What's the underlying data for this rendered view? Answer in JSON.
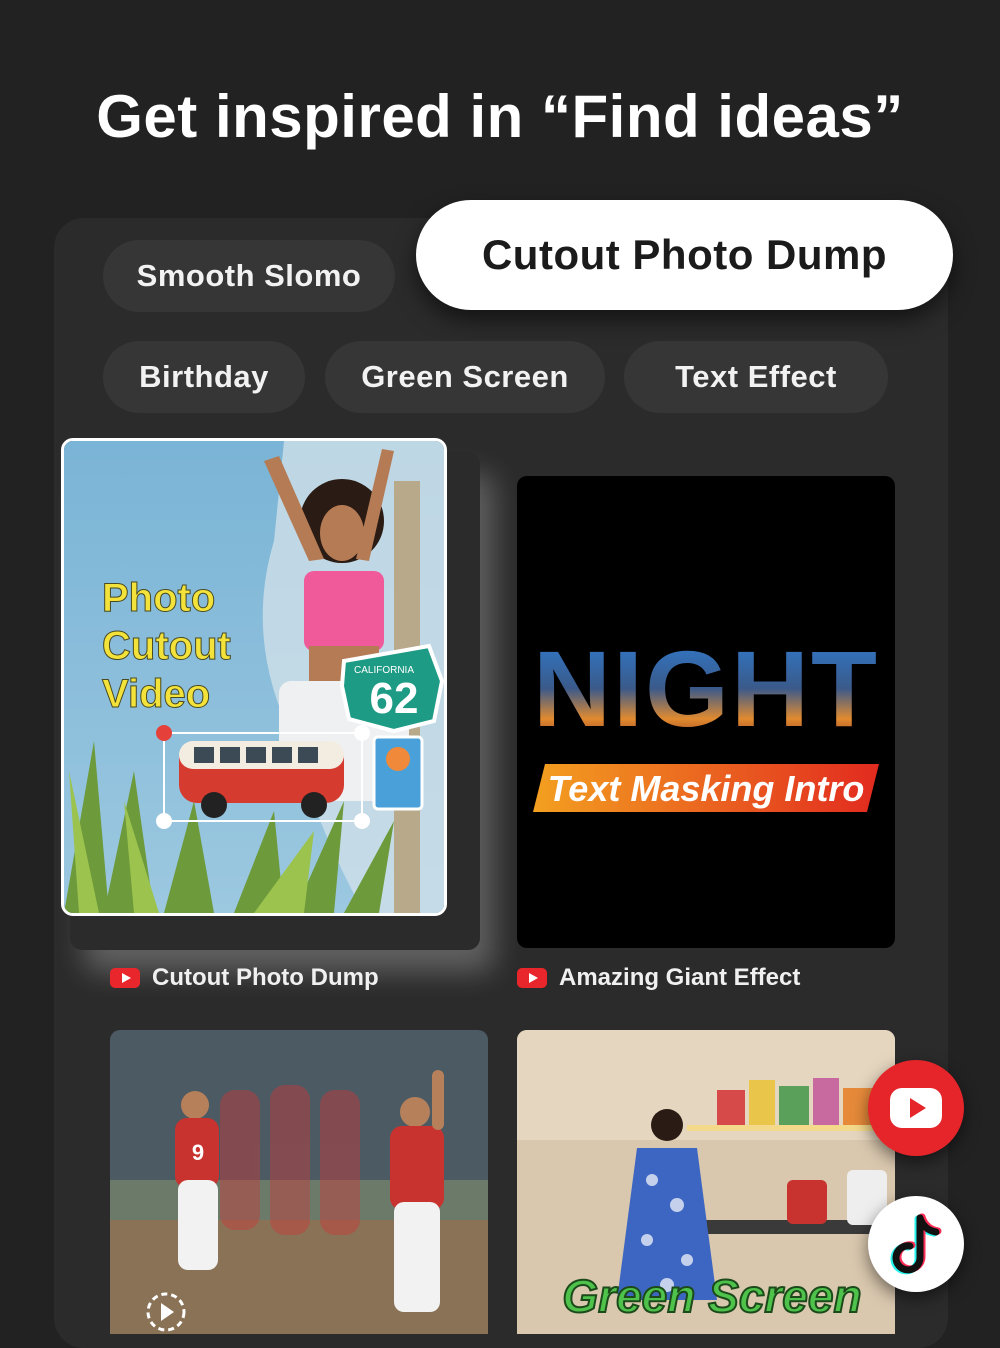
{
  "headline": "Get inspired in “Find ideas”",
  "chips": {
    "smooth_slomo": "Smooth Slomo",
    "cutout_photo_dump": "Cutout Photo Dump",
    "birthday": "Birthday",
    "green_screen": "Green Screen",
    "text_effect": "Text Effect"
  },
  "cards": [
    {
      "title": "Cutout Photo Dump",
      "source_icon": "youtube-icon",
      "overlay_lines": [
        "Photo",
        "Cutout",
        "Video"
      ],
      "sign_text": "CALIFORNIA",
      "sign_number": "62"
    },
    {
      "title": "Amazing Giant Effect",
      "source_icon": "youtube-icon",
      "big_word": "NIGHT",
      "banner": "Text Masking Intro"
    },
    {
      "title": "",
      "overlay": "",
      "player_number": "9"
    },
    {
      "title": "",
      "overlay": "Green Screen"
    }
  ],
  "floating_buttons": [
    "youtube-icon",
    "tiktok-icon"
  ],
  "colors": {
    "background": "#222222",
    "panel": "#2b2b2b",
    "youtube_red": "#e8262b",
    "highlight_yellow": "#f2e23a"
  }
}
